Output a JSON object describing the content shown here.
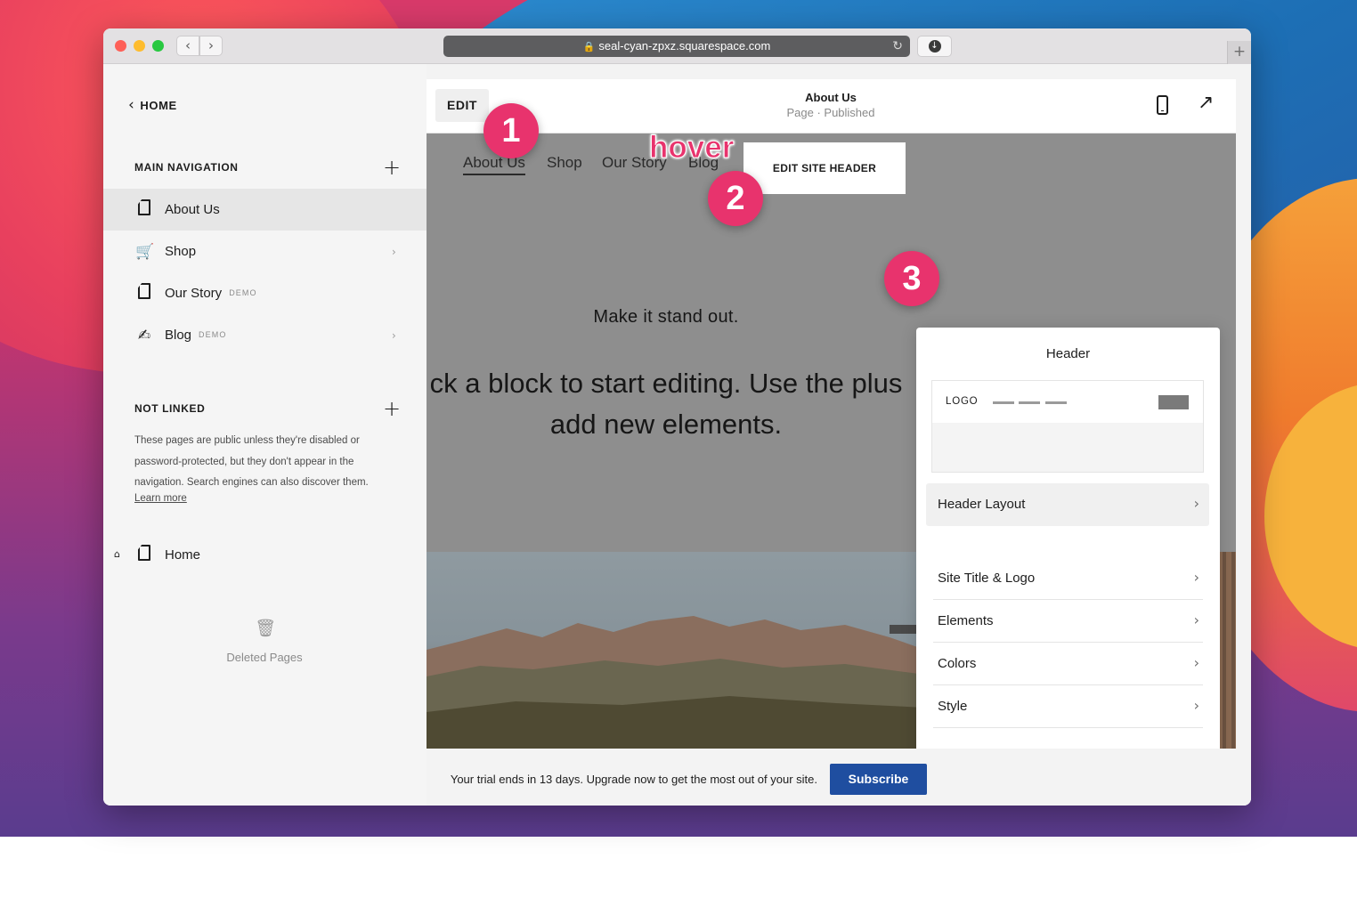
{
  "browser": {
    "url": "seal-cyan-zpxz.squarespace.com"
  },
  "sidebar": {
    "home_label": "HOME",
    "main_navigation": {
      "label": "MAIN NAVIGATION",
      "items": [
        {
          "label": "About Us",
          "badge": "",
          "icon": "page-icon"
        },
        {
          "label": "Shop",
          "badge": "",
          "icon": "cart-icon"
        },
        {
          "label": "Our Story",
          "badge": "DEMO",
          "icon": "page-icon"
        },
        {
          "label": "Blog",
          "badge": "DEMO",
          "icon": "blog-icon"
        }
      ]
    },
    "not_linked": {
      "label": "NOT LINKED",
      "description": "These pages are public unless they're disabled or password-protected, but they don't appear in the navigation. Search engines can also discover them.",
      "learn_more": "Learn more",
      "home_page": "Home"
    },
    "deleted_pages": "Deleted Pages"
  },
  "editor": {
    "edit_label": "EDIT",
    "page_title": "About Us",
    "page_status": "Page · Published"
  },
  "site": {
    "nav": [
      "About Us",
      "Shop",
      "Our Story",
      "Blog"
    ],
    "edit_site_header": "EDIT SITE HEADER",
    "hero_sub": "Make it stand out.",
    "hero_line1": "ck a block to start editing. Use the plus",
    "hero_line2": "add new elements."
  },
  "header_panel": {
    "title": "Header",
    "logo_text": "LOGO",
    "rows": [
      "Header Layout",
      "Site Title & Logo",
      "Elements",
      "Colors",
      "Style"
    ]
  },
  "trial": {
    "message": "Your trial ends in 13 days. Upgrade now to get the most out of your site.",
    "subscribe": "Subscribe"
  },
  "annotations": {
    "badge_1": "1",
    "badge_2": "2",
    "badge_3": "3",
    "hover": "hover"
  },
  "colors": {
    "accent_pink": "#e8336d",
    "subscribe_blue": "#1f4ea0"
  }
}
